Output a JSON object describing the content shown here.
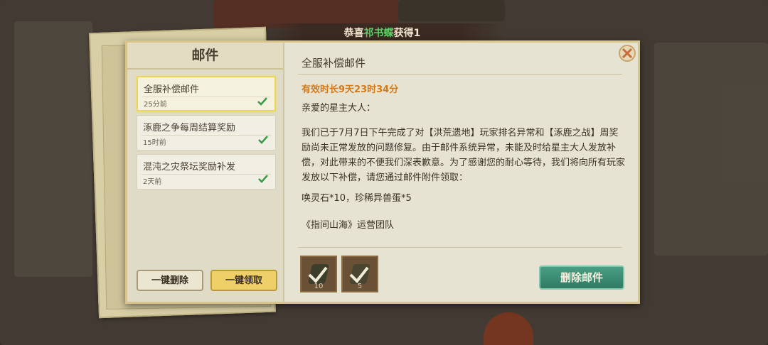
{
  "banner": {
    "prefix": "恭喜",
    "player": "祁书蝶",
    "suffix": "获得1"
  },
  "left_panel": {
    "title": "邮件",
    "mails": [
      {
        "title": "全服补偿邮件",
        "time": "25分前",
        "selected": true
      },
      {
        "title": "涿鹿之争每周结算奖励",
        "time": "15时前",
        "selected": false
      },
      {
        "title": "混沌之灾祭坛奖励补发",
        "time": "2天前",
        "selected": false
      }
    ],
    "delete_all_label": "一键删除",
    "claim_all_label": "一键领取"
  },
  "mail": {
    "title": "全服补偿邮件",
    "validity": "有效时长9天23时34分",
    "greeting": "亲爱的星主大人：",
    "body": "我们已于7月7日下午完成了对【洪荒遗地】玩家排名异常和【涿鹿之战】周奖励尚未正常发放的问题修复。由于邮件系统异常，未能及时给星主大人发放补偿，对此带来的不便我们深表歉意。为了感谢您的耐心等待，我们将向所有玩家发放以下补偿，请您通过邮件附件领取：",
    "rewards_text": "唤灵石*10，珍稀异兽蛋*5",
    "signature": "《指间山海》运营团队",
    "attachments": [
      {
        "icon": "spirit-stone-icon",
        "quantity": "10"
      },
      {
        "icon": "beast-egg-icon",
        "quantity": "5"
      }
    ],
    "delete_label": "删除邮件"
  },
  "colors": {
    "accent_orange": "#d47a18",
    "delete_button": "#3a8a71",
    "claim_button": "#efcf67",
    "player_name": "#5fd06a"
  }
}
